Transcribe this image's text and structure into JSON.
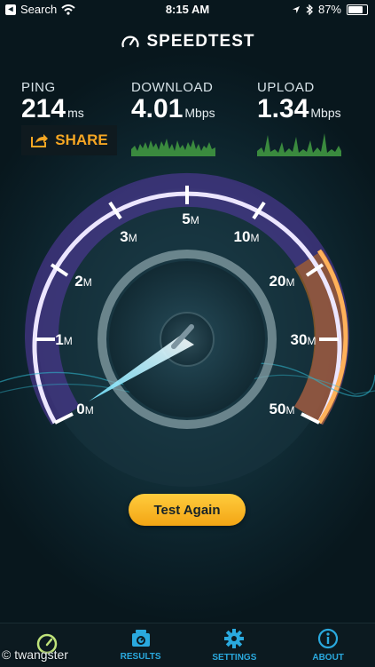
{
  "status_bar": {
    "back_label": "Search",
    "time": "8:15 AM",
    "battery": "87%",
    "battery_level": 0.87
  },
  "brand": {
    "name": "SPEEDTEST"
  },
  "metrics": {
    "ping": {
      "label": "PING",
      "value": "214",
      "unit": "ms"
    },
    "download": {
      "label": "DOWNLOAD",
      "value": "4.01",
      "unit": "Mbps"
    },
    "upload": {
      "label": "UPLOAD",
      "value": "1.34",
      "unit": "Mbps"
    }
  },
  "share_label": "SHARE",
  "gauge": {
    "ticks": [
      {
        "num": "0",
        "unit": "M"
      },
      {
        "num": "1",
        "unit": "M"
      },
      {
        "num": "2",
        "unit": "M"
      },
      {
        "num": "3",
        "unit": "M"
      },
      {
        "num": "5",
        "unit": "M"
      },
      {
        "num": "10",
        "unit": "M"
      },
      {
        "num": "20",
        "unit": "M"
      },
      {
        "num": "30",
        "unit": "M"
      },
      {
        "num": "50",
        "unit": "M"
      }
    ]
  },
  "test_again_label": "Test Again",
  "tabs": [
    {
      "label": "",
      "icon": "speedometer-icon"
    },
    {
      "label": "RESULTS",
      "icon": "results-icon"
    },
    {
      "label": "SETTINGS",
      "icon": "gear-icon"
    },
    {
      "label": "ABOUT",
      "icon": "info-icon"
    }
  ],
  "watermark": "© twangster",
  "colors": {
    "accent_orange": "#f5a623",
    "accent_blue": "#2aa9de",
    "gauge_purple": "#8a4fd6"
  }
}
